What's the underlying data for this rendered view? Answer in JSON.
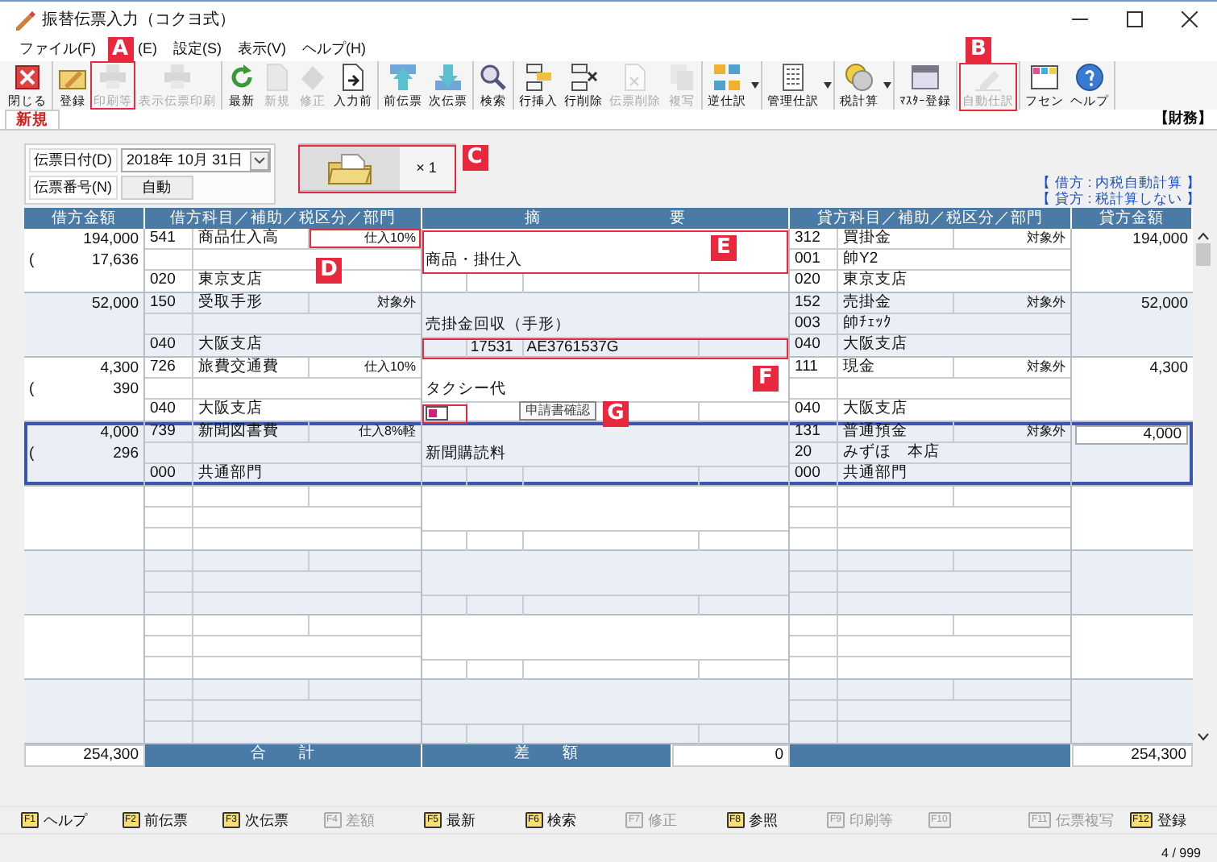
{
  "window": {
    "title": "振替伝票入力（コクヨ式）"
  },
  "menu": [
    {
      "label": "ファイル(F)"
    },
    {
      "label": "(E)"
    },
    {
      "label": "設定(S)"
    },
    {
      "label": "表示(V)"
    },
    {
      "label": "ヘルプ(H)"
    }
  ],
  "toolbar": [
    [
      {
        "label": "閉じる",
        "disabled": false
      }
    ],
    [
      {
        "label": "登録",
        "disabled": false
      },
      {
        "label": "印刷等",
        "disabled": true
      },
      {
        "label": "表示伝票印刷",
        "disabled": true
      }
    ],
    [
      {
        "label": "最新",
        "disabled": false
      },
      {
        "label": "新規",
        "disabled": true
      },
      {
        "label": "修正",
        "disabled": true
      },
      {
        "label": "入力前",
        "disabled": false
      }
    ],
    [
      {
        "label": "前伝票",
        "disabled": false
      },
      {
        "label": "次伝票",
        "disabled": false
      }
    ],
    [
      {
        "label": "検索",
        "disabled": false
      }
    ],
    [
      {
        "label": "行挿入",
        "disabled": false
      },
      {
        "label": "行削除",
        "disabled": false
      },
      {
        "label": "伝票削除",
        "disabled": true
      },
      {
        "label": "複写",
        "disabled": true
      }
    ],
    [
      {
        "label": "逆仕訳",
        "disabled": false,
        "dropdown": true
      }
    ],
    [
      {
        "label": "管理仕訳",
        "disabled": false,
        "dropdown": true
      }
    ],
    [
      {
        "label": "税計算",
        "disabled": false,
        "dropdown": true
      }
    ],
    [
      {
        "label": "ﾏｽﾀｰ登録",
        "disabled": false
      }
    ],
    [
      {
        "label": "自動仕訳",
        "disabled": true
      }
    ],
    [
      {
        "label": "フセン",
        "disabled": false
      },
      {
        "label": "ヘルプ",
        "disabled": false
      }
    ]
  ],
  "tab": {
    "label": "新規"
  },
  "section": "【財務】",
  "header": {
    "date_label": "伝票日付(D)",
    "date_value": "2018年 10月 31日",
    "number_label": "伝票番号(N)",
    "number_button": "自動",
    "attachment_count": "× 1"
  },
  "tax_notes": [
    "【 借方 : 内税自動計算 】",
    "【 貸方 : 税計算しない 】"
  ],
  "table": {
    "columns": [
      "借方金額",
      "借方科目／補助／税区分／部門",
      "摘　　　　　　　　要",
      "貸方科目／補助／税区分／部門",
      "貸方金額"
    ],
    "entries": [
      {
        "selected": false,
        "debit": {
          "amount": "194,000",
          "tax_prefix": "(",
          "tax": "17,636",
          "code": "541",
          "name": "商品仕入高",
          "tax_class": "仕入10%",
          "dept_code": "020",
          "dept_name": "東京支店"
        },
        "description": "商品・掛仕入",
        "form_icon": false,
        "credit": {
          "code": "312",
          "name": "買掛金",
          "tax_class": "対象外",
          "sub_code": "001",
          "sub_name": "帥Y2",
          "dept_code": "020",
          "dept_name": "東京支店",
          "amount": "194,000"
        }
      },
      {
        "selected": false,
        "debit": {
          "amount": "52,000",
          "code": "150",
          "name": "受取手形",
          "tax_class": "対象外",
          "dept_code": "040",
          "dept_name": "大阪支店"
        },
        "description": "売掛金回収（手形）",
        "refs": [
          "17531",
          "AE3761537G"
        ],
        "form_icon": false,
        "credit": {
          "code": "152",
          "name": "売掛金",
          "tax_class": "対象外",
          "sub_code": "003",
          "sub_name": "帥ﾁｪｯｸ",
          "dept_code": "040",
          "dept_name": "大阪支店",
          "amount": "52,000"
        }
      },
      {
        "selected": false,
        "debit": {
          "amount": "4,300",
          "tax_prefix": "(",
          "tax": "390",
          "code": "726",
          "name": "旅費交通費",
          "tax_class": "仕入10%",
          "dept_code": "040",
          "dept_name": "大阪支店"
        },
        "description": "タクシー代",
        "form_icon": true,
        "credit": {
          "code": "111",
          "name": "現金",
          "tax_class": "対象外",
          "dept_code": "040",
          "dept_name": "大阪支店",
          "amount": "4,300"
        }
      },
      {
        "selected": true,
        "debit": {
          "amount": "4,000",
          "tax_prefix": "(",
          "tax": "296",
          "code": "739",
          "name": "新聞図書費",
          "tax_class": "仕入8%軽",
          "dept_code": "000",
          "dept_name": "共通部門"
        },
        "description": "新聞購読料",
        "form_icon": false,
        "credit": {
          "code": "131",
          "name": "普通預金",
          "tax_class": "対象外",
          "sub_code": "20",
          "sub_name": "みずほ　本店",
          "dept_code": "000",
          "dept_name": "共通部門",
          "amount": "4,000"
        }
      }
    ],
    "totals": {
      "debit": "254,300",
      "label": "合　　計",
      "diff_label": "差　　額",
      "diff": "0",
      "credit": "254,300"
    }
  },
  "tooltip": "申請書確認",
  "function_keys": [
    {
      "key": "F1",
      "label": "ヘルプ",
      "disabled": false
    },
    {
      "key": "F2",
      "label": "前伝票",
      "disabled": false
    },
    {
      "key": "F3",
      "label": "次伝票",
      "disabled": false
    },
    {
      "key": "F4",
      "label": "差額",
      "disabled": true
    },
    {
      "key": "F5",
      "label": "最新",
      "disabled": false
    },
    {
      "key": "F6",
      "label": "検索",
      "disabled": false
    },
    {
      "key": "F7",
      "label": "修正",
      "disabled": true
    },
    {
      "key": "F8",
      "label": "参照",
      "disabled": false
    },
    {
      "key": "F9",
      "label": "印刷等",
      "disabled": true
    },
    {
      "key": "F10",
      "disabled": true
    },
    {
      "key": "F11",
      "label": "伝票複写",
      "disabled": true
    },
    {
      "key": "F12",
      "label": "登録",
      "disabled": false
    }
  ],
  "status": "4 / 999",
  "callouts": [
    {
      "label": "A"
    },
    {
      "label": "B"
    },
    {
      "label": "C"
    },
    {
      "label": "D"
    },
    {
      "label": "E"
    },
    {
      "label": "F"
    },
    {
      "label": "G"
    }
  ]
}
